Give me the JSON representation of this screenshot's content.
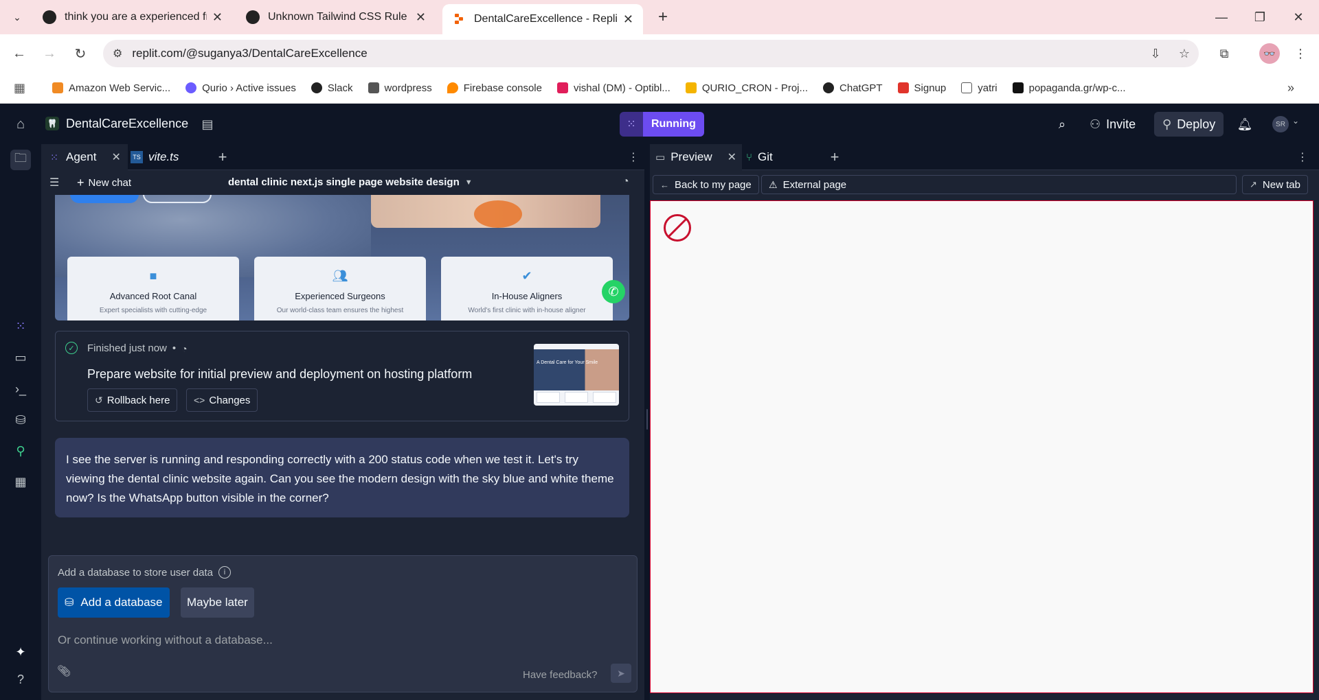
{
  "browser": {
    "tabs": [
      {
        "title": "think you are a experienced fron"
      },
      {
        "title": "Unknown Tailwind CSS Rule"
      },
      {
        "title": "DentalCareExcellence - Replit"
      }
    ],
    "url": "replit.com/@suganya3/DentalCareExcellence",
    "bookmarks": [
      {
        "label": "Amazon Web Servic...",
        "color": "#f08a24"
      },
      {
        "label": "Qurio › Active issues",
        "color": "#6b5cff"
      },
      {
        "label": "Slack",
        "color": "#222222"
      },
      {
        "label": "wordpress",
        "color": "#555555"
      },
      {
        "label": "Firebase console",
        "color": "#ff8a00"
      },
      {
        "label": "vishal (DM) - Optibl...",
        "color": "#e01e5a"
      },
      {
        "label": "QURIO_CRON - Proj...",
        "color": "#f4b400"
      },
      {
        "label": "ChatGPT",
        "color": "#222222"
      },
      {
        "label": "Signup",
        "color": "#e0342b"
      },
      {
        "label": "yatri",
        "color": "#555555"
      },
      {
        "label": "popaganda.gr/wp-c...",
        "color": "#111111"
      }
    ],
    "profile_initials": "👓"
  },
  "replit": {
    "project_name": "DentalCareExcellence",
    "run_label": "Running",
    "invite_label": "Invite",
    "deploy_label": "Deploy",
    "avatar_initials": "SR"
  },
  "agent_pane": {
    "tabs": [
      {
        "label": "Agent"
      },
      {
        "label": "vite.ts"
      }
    ],
    "new_chat_label": "New chat",
    "chat_title": "dental clinic next.js single page website design",
    "site_preview": {
      "features": [
        {
          "title": "Advanced Root Canal",
          "desc": "Expert specialists with cutting-edge",
          "icon": "folder-icon"
        },
        {
          "title": "Experienced Surgeons",
          "desc": "Our world-class team ensures the highest",
          "icon": "users-icon"
        },
        {
          "title": "In-House Aligners",
          "desc": "World's first clinic with in-house aligner",
          "icon": "verified-badge-icon"
        }
      ]
    },
    "checkpoint": {
      "status": "Finished just now",
      "separator": "•",
      "title": "Prepare website for initial preview and deployment on hosting platform",
      "rollback_label": "Rollback here",
      "changes_label": "Changes",
      "thumb_text": "A Dental Care for Your Smile"
    },
    "message": "I see the server is running and responding correctly with a 200 status code when we test it. Let's try viewing the dental clinic website again. Can you see the modern design with the sky blue and white theme now? Is the WhatsApp button visible in the corner?",
    "database_prompt": {
      "heading": "Add a database to store user data",
      "add_label": "Add a database",
      "later_label": "Maybe later",
      "input_placeholder": "Or continue working without a database...",
      "feedback_label": "Have feedback?"
    }
  },
  "preview_pane": {
    "tabs": [
      {
        "label": "Preview"
      },
      {
        "label": "Git"
      }
    ],
    "back_label": "Back to my page",
    "address_label": "External page",
    "new_tab_label": "New tab"
  },
  "colors": {
    "accent": "#6c4cf1",
    "primary_button": "#0053a6",
    "success": "#3ecf8e",
    "blocked": "#d8002b"
  }
}
